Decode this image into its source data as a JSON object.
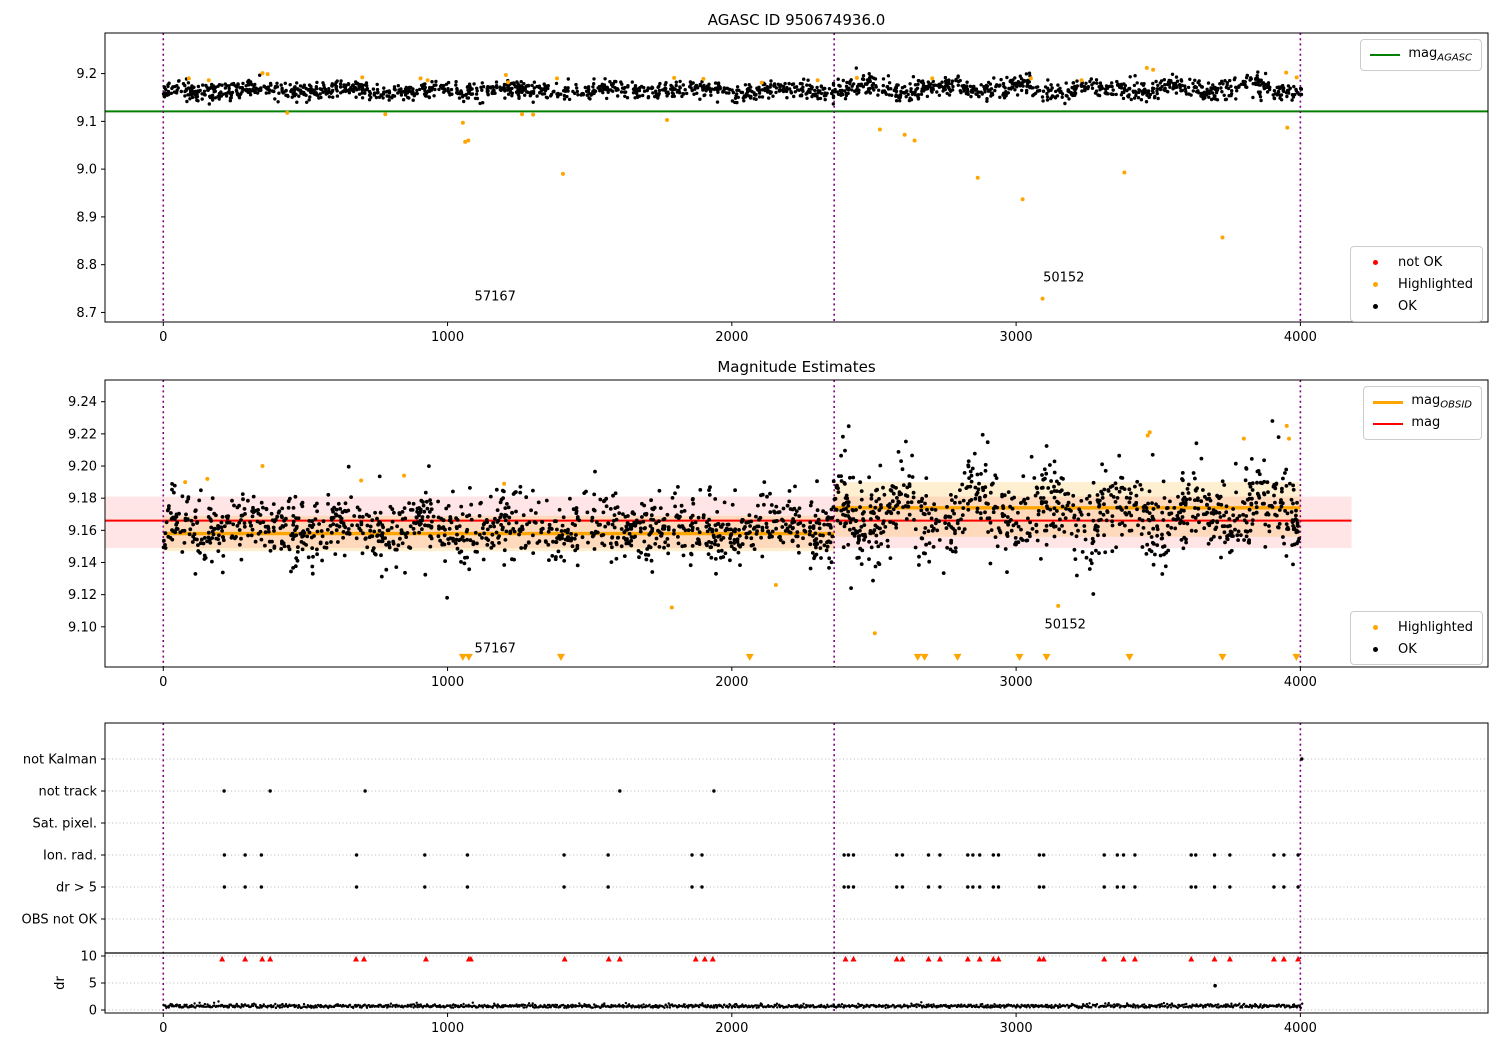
{
  "colors": {
    "ok": "#000000",
    "highlighted": "#ffa500",
    "not_ok": "#ff0000",
    "mag_agasc_line": "#008000",
    "mag_line": "#ff0000",
    "mag_obsid_line": "#ffa500",
    "vline": "#800080",
    "grid": "#b8b8b8",
    "band_red": "rgba(255,0,0,0.10)",
    "band_orange": "rgba(255,165,0,0.18)"
  },
  "chart_data": [
    {
      "type": "scatter",
      "title": "AGASC ID 950674936.0",
      "xlim": [
        -205,
        4660
      ],
      "ylim": [
        8.68,
        9.285
      ],
      "xticks": [
        0,
        1000,
        2000,
        3000,
        4000
      ],
      "xtick_labels": [
        "0",
        "1000",
        "2000",
        "3000",
        "4000"
      ],
      "yticks": [
        9.2,
        9.1,
        9.0,
        8.9,
        8.8,
        8.7
      ],
      "ytick_labels": [
        "9.2",
        "9.1",
        "9.0",
        "8.9",
        "8.8",
        "8.7"
      ],
      "grid": false,
      "vlines": {
        "x": [
          0,
          2360,
          4000
        ],
        "color": "#800080"
      },
      "hlines": [
        {
          "y": 9.121,
          "x0": -205,
          "x1": 4660,
          "color": "#008000",
          "width": 2,
          "name": "mag-agasc-line"
        }
      ],
      "legends": {
        "top_right": {
          "entries": [
            {
              "swatch": "line",
              "color": "#008000",
              "label": "mag",
              "sub": "AGASC"
            }
          ]
        },
        "bottom_right": {
          "entries": [
            {
              "swatch": "dot",
              "color": "#ff0000",
              "label": "not OK"
            },
            {
              "swatch": "dot",
              "color": "#ffa500",
              "label": "Highlighted"
            },
            {
              "swatch": "dot",
              "color": "#000000",
              "label": "OK"
            }
          ]
        }
      },
      "annotations": [
        {
          "text": "57167",
          "x": 1095,
          "y": 8.725
        },
        {
          "text": "50152",
          "x": 3095,
          "y": 8.765
        }
      ],
      "ok_points": {
        "color": "#000000",
        "radius": 1.7,
        "gen": {
          "seed": 20,
          "clip": [
            9.132,
            9.213
          ],
          "segments": [
            {
              "x0": 0,
              "x1": 2355,
              "n": 1050,
              "mean": 9.165,
              "sd": 0.0085,
              "amp": 0.004,
              "period": 310,
              "phase": 1.2,
              "spike_p": 0.02,
              "spike_amp": 0.01,
              "dip_p": 0.02,
              "dip_amp": 0.008
            },
            {
              "x0": 2355,
              "x1": 4005,
              "n": 760,
              "mean": 9.168,
              "sd": 0.01,
              "amp": 0.008,
              "period": 270,
              "phase": 0.4,
              "spike_p": 0.06,
              "spike_amp": 0.014,
              "dip_p": 0.02,
              "dip_amp": 0.01
            }
          ]
        }
      },
      "highlighted_points": {
        "color": "#ffa500",
        "radius": 2.0,
        "points": [
          [
            90,
            9.19
          ],
          [
            160,
            9.186
          ],
          [
            349,
            9.201
          ],
          [
            367,
            9.199
          ],
          [
            700,
            9.192
          ],
          [
            905,
            9.19
          ],
          [
            930,
            9.186
          ],
          [
            1205,
            9.197
          ],
          [
            1213,
            9.182
          ],
          [
            1385,
            9.19
          ],
          [
            1797,
            9.191
          ],
          [
            1900,
            9.189
          ],
          [
            2105,
            9.181
          ],
          [
            2302,
            9.186
          ],
          [
            2440,
            9.191
          ],
          [
            2705,
            9.19
          ],
          [
            3052,
            9.19
          ],
          [
            3230,
            9.186
          ],
          [
            3460,
            9.212
          ],
          [
            3482,
            9.208
          ],
          [
            3950,
            9.202
          ],
          [
            3987,
            9.192
          ],
          [
            436,
            9.118
          ],
          [
            781,
            9.115
          ],
          [
            1054,
            9.097
          ],
          [
            1062,
            9.057
          ],
          [
            1073,
            9.06
          ],
          [
            1262,
            9.115
          ],
          [
            1301,
            9.114
          ],
          [
            1406,
            8.99
          ],
          [
            1772,
            9.103
          ],
          [
            2521,
            9.083
          ],
          [
            2608,
            9.072
          ],
          [
            2643,
            9.06
          ],
          [
            2865,
            8.982
          ],
          [
            3023,
            8.937
          ],
          [
            3093,
            8.729
          ],
          [
            3381,
            8.993
          ],
          [
            3726,
            8.857
          ],
          [
            3954,
            9.087
          ]
        ]
      }
    },
    {
      "type": "scatter",
      "title": "Magnitude Estimates",
      "xlim": [
        -205,
        4660
      ],
      "ylim": [
        9.075,
        9.2535
      ],
      "xticks": [
        0,
        1000,
        2000,
        3000,
        4000
      ],
      "xtick_labels": [
        "0",
        "1000",
        "2000",
        "3000",
        "4000"
      ],
      "yticks": [
        9.24,
        9.22,
        9.2,
        9.18,
        9.16,
        9.14,
        9.12,
        9.1
      ],
      "ytick_labels": [
        "9.24",
        "9.22",
        "9.20",
        "9.18",
        "9.16",
        "9.14",
        "9.12",
        "9.10"
      ],
      "grid": false,
      "vlines": {
        "x": [
          0,
          2360,
          4000
        ],
        "color": "#800080"
      },
      "bands": [
        {
          "x0": -205,
          "x1": 4180,
          "y0": 9.149,
          "y1": 9.181,
          "color": "rgba(255,0,0,0.10)"
        },
        {
          "x0": 0,
          "x1": 2360,
          "y0": 9.147,
          "y1": 9.169,
          "color": "rgba(255,165,0,0.18)"
        },
        {
          "x0": 2360,
          "x1": 4000,
          "y0": 9.156,
          "y1": 9.19,
          "color": "rgba(255,165,0,0.18)"
        }
      ],
      "hlines": [
        {
          "y": 9.166,
          "x0": -205,
          "x1": 4180,
          "color": "#ff0000",
          "width": 2,
          "name": "mag-line"
        }
      ],
      "segments": [
        {
          "y": 9.158,
          "x0": 0,
          "x1": 2360,
          "color": "#ffa500",
          "width": 3.4,
          "name": "mag-obsid-1"
        },
        {
          "y": 9.174,
          "x0": 2360,
          "x1": 4000,
          "color": "#ffa500",
          "width": 3.4,
          "name": "mag-obsid-2"
        }
      ],
      "legends": {
        "top_right": {
          "entries": [
            {
              "swatch": "line-thick",
              "color": "#ffa500",
              "label": "mag",
              "sub": "OBSID"
            },
            {
              "swatch": "line",
              "color": "#ff0000",
              "label": "mag",
              "sub": ""
            }
          ]
        },
        "bottom_right": {
          "entries": [
            {
              "swatch": "dot",
              "color": "#ffa500",
              "label": "Highlighted"
            },
            {
              "swatch": "dot",
              "color": "#000000",
              "label": "OK"
            }
          ]
        }
      },
      "annotations": [
        {
          "text": "57167",
          "x": 1095,
          "y": 9.084
        },
        {
          "text": "50152",
          "x": 3100,
          "y": 9.099
        }
      ],
      "clip_markers": {
        "shape": "triangle-down",
        "color": "#ffa500",
        "y": 9.081,
        "x": [
          1054,
          1075,
          1399,
          2063,
          2654,
          2678,
          2794,
          3012,
          3107,
          3399,
          3726,
          3986
        ]
      },
      "ok_points": {
        "color": "#000000",
        "radius": 1.9,
        "gen": {
          "seed": 77,
          "clip": [
            9.093,
            9.228
          ],
          "segments": [
            {
              "x0": 0,
              "x1": 2355,
              "n": 1150,
              "mean": 9.162,
              "sd": 0.01,
              "amp": 0.0045,
              "period": 300,
              "phase": 0.8,
              "spike_p": 0.02,
              "spike_amp": 0.012,
              "dip_p": 0.03,
              "dip_amp": 0.012
            },
            {
              "x0": 2355,
              "x1": 4000,
              "n": 900,
              "mean": 9.171,
              "sd": 0.012,
              "amp": 0.009,
              "period": 255,
              "phase": 0.2,
              "spike_p": 0.09,
              "spike_amp": 0.016,
              "dip_p": 0.03,
              "dip_amp": 0.014
            }
          ]
        }
      },
      "highlighted_points": {
        "color": "#ffa500",
        "radius": 2.0,
        "points": [
          [
            77,
            9.19
          ],
          [
            155,
            9.192
          ],
          [
            349,
            9.2
          ],
          [
            696,
            9.191
          ],
          [
            847,
            9.194
          ],
          [
            1199,
            9.189
          ],
          [
            1789,
            9.112
          ],
          [
            2155,
            9.126
          ],
          [
            2503,
            9.096
          ],
          [
            3148,
            9.113
          ],
          [
            3463,
            9.219
          ],
          [
            3470,
            9.221
          ],
          [
            3801,
            9.217
          ],
          [
            3952,
            9.225
          ],
          [
            3960,
            9.217
          ]
        ]
      }
    },
    {
      "type": "categorical",
      "title": "",
      "xlim": [
        -205,
        4660
      ],
      "xticks": [
        0,
        1000,
        2000,
        3000,
        4000
      ],
      "xtick_labels": [
        "0",
        "1000",
        "2000",
        "3000",
        "4000"
      ],
      "grid": true,
      "vlines": {
        "x": [
          0,
          2360,
          4000
        ],
        "color": "#800080"
      },
      "rows": [
        {
          "label": "not Kalman",
          "points": [
            4005
          ]
        },
        {
          "label": "not track",
          "points": [
            214,
            376,
            710,
            1606,
            1937
          ]
        },
        {
          "label": "Sat. pixel.",
          "points": []
        },
        {
          "label": "Ion. rad.",
          "points": [
            215,
            288,
            345,
            680,
            920,
            1070,
            1410,
            1565,
            1860,
            1895,
            2395,
            2410,
            2428,
            2580,
            2600,
            2692,
            2732,
            2830,
            2848,
            2872,
            2920,
            2938,
            3082,
            3097,
            3310,
            3356,
            3378,
            3418,
            3616,
            3632,
            3698,
            3752,
            3907,
            3942,
            3992
          ]
        },
        {
          "label": "dr > 5",
          "points": [
            215,
            288,
            345,
            680,
            920,
            1070,
            1410,
            1565,
            1860,
            1895,
            2395,
            2410,
            2428,
            2580,
            2600,
            2692,
            2732,
            2830,
            2848,
            2872,
            2920,
            2938,
            3082,
            3097,
            3310,
            3356,
            3378,
            3418,
            3616,
            3632,
            3698,
            3752,
            3907,
            3942,
            3992
          ]
        },
        {
          "label": "OBS not OK",
          "points": []
        }
      ],
      "row_point_color": "#000000",
      "dr": {
        "label": "dr",
        "ticks": [
          10,
          5,
          0
        ],
        "tick_labels": [
          "10",
          "5",
          "0"
        ],
        "separator": 10.55,
        "red_markers": {
          "color": "#ff0000",
          "y": 9.5,
          "x": [
            207,
            288,
            348,
            376,
            678,
            706,
            924,
            1075,
            1082,
            1412,
            1567,
            1606,
            1873,
            1905,
            1933,
            2400,
            2428,
            2580,
            2600,
            2692,
            2732,
            2830,
            2872,
            2920,
            2938,
            3082,
            3097,
            3310,
            3378,
            3418,
            3616,
            3698,
            3752,
            3907,
            3942,
            3992
          ]
        },
        "trace": {
          "color": "#000000",
          "gen": {
            "seed": 5,
            "n": 1400,
            "x0": 0,
            "x1": 4005,
            "base": 0.35,
            "span": 0.45,
            "noise": 0.18,
            "max": 1.9
          }
        },
        "outliers": [
          [
            3700,
            4.5
          ]
        ]
      }
    }
  ]
}
